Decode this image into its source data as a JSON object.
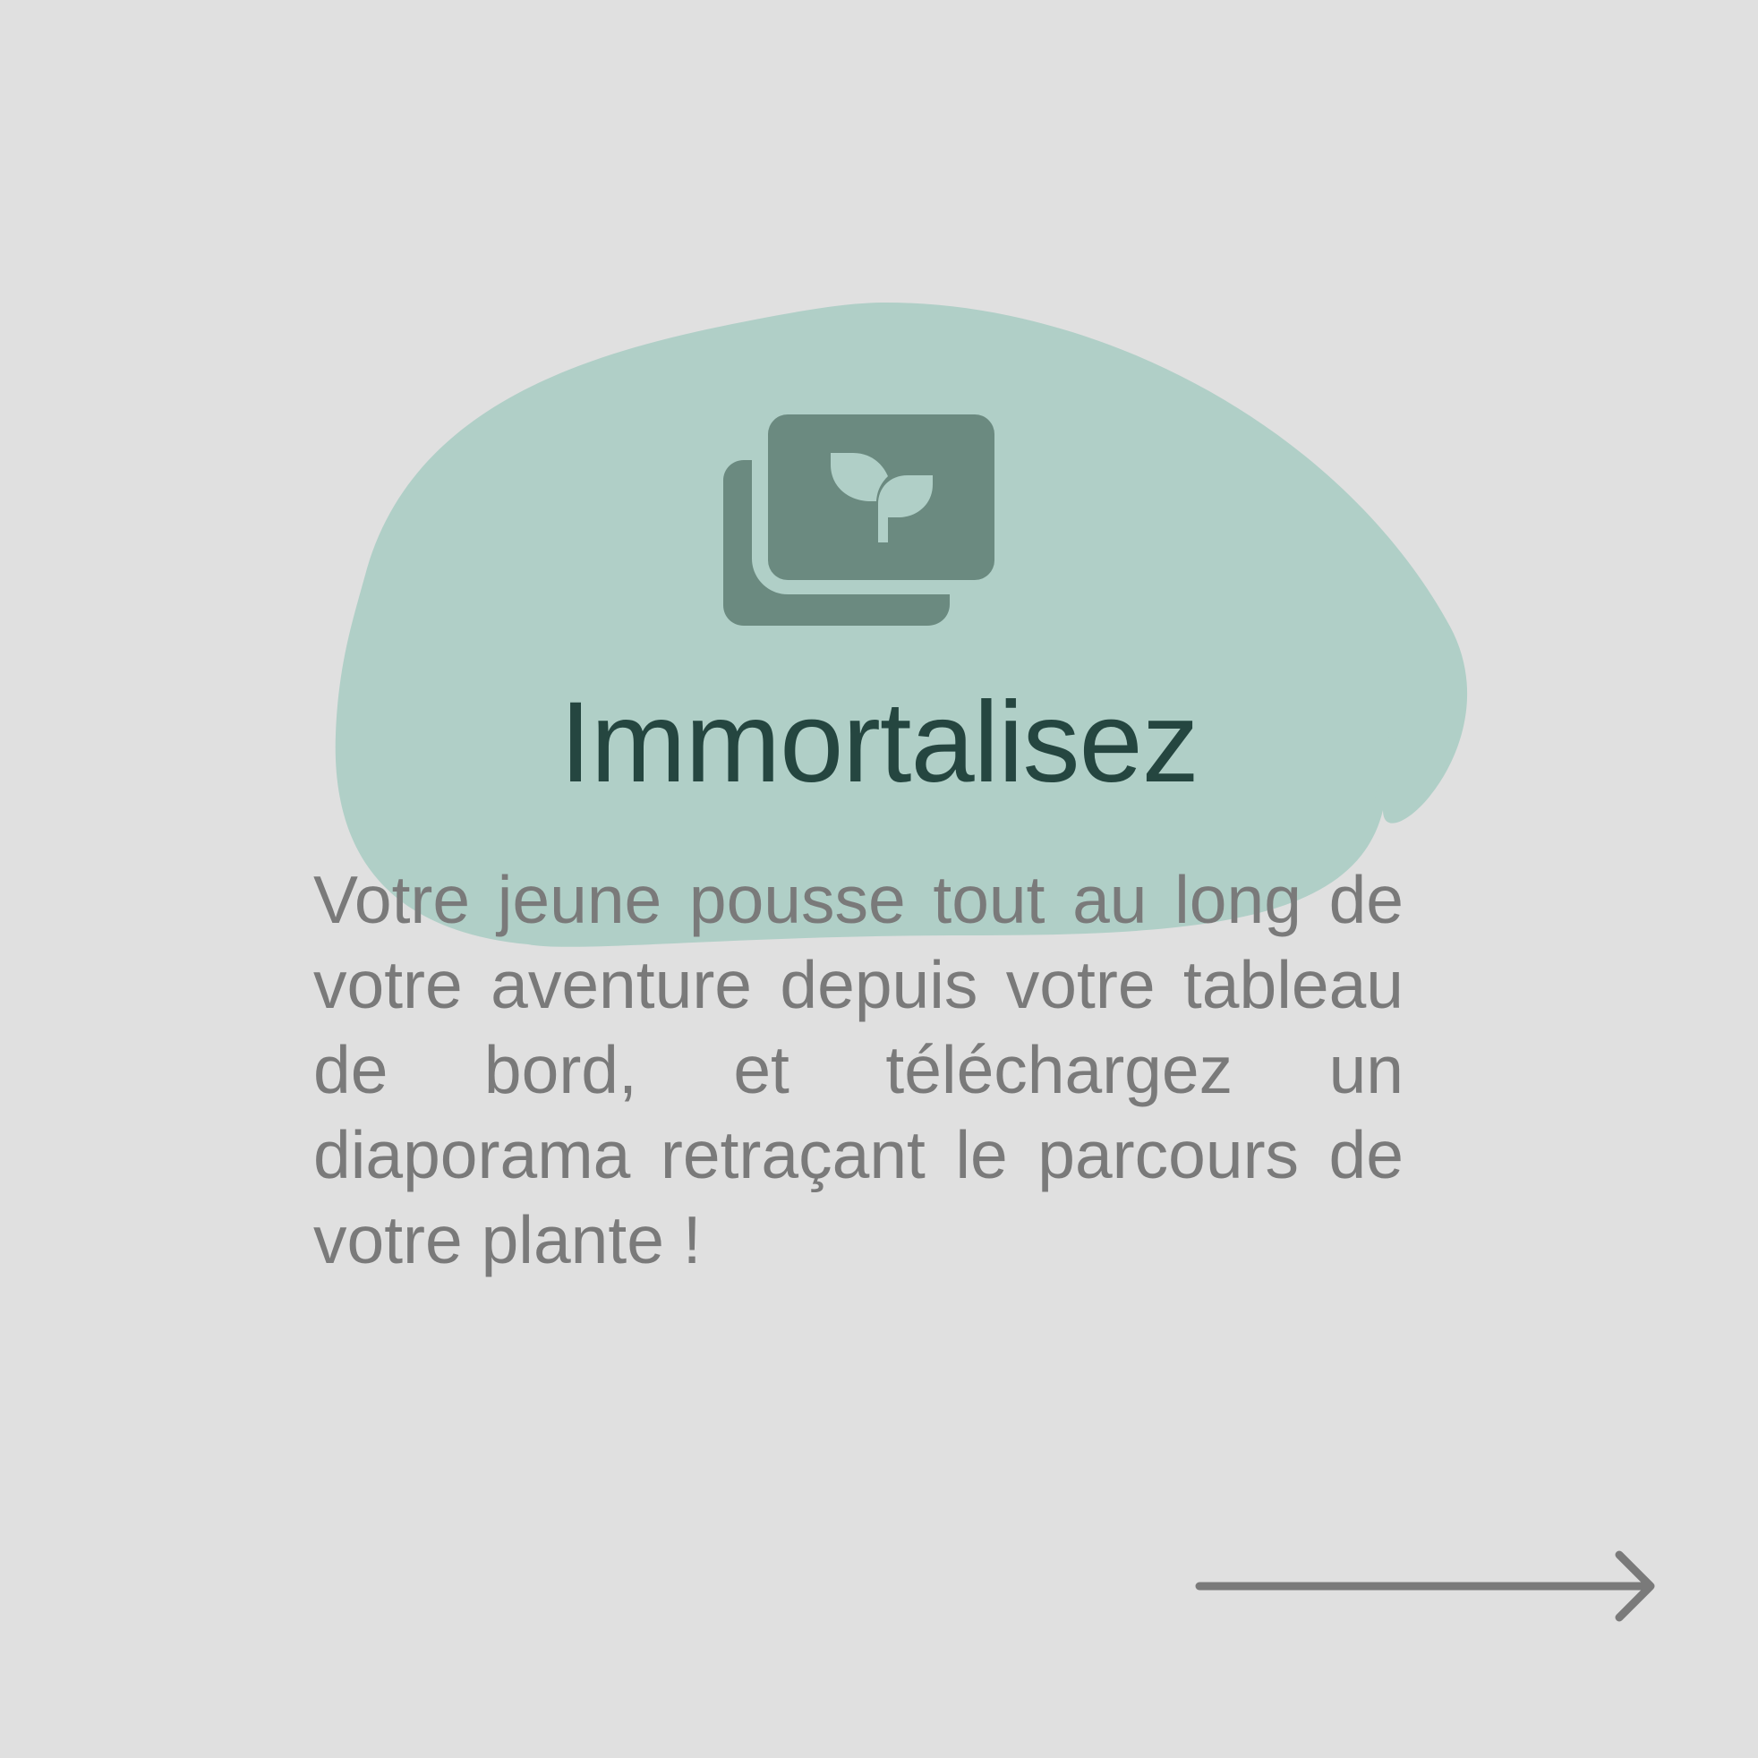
{
  "slide": {
    "title": "Immortalisez",
    "body": "Votre jeune pousse tout au long de votre aventure depuis votre tableau de bord, et téléchargez un diaporama retraçant le parcours de votre plante !"
  },
  "icons": {
    "hero": "photo-stack-sprout-icon",
    "next": "arrow-right-icon"
  },
  "colors": {
    "background": "#e0e0e0",
    "blob": "#b0cfc7",
    "icon": "#6b8a80",
    "title": "#254640",
    "body_text": "#7a7a7a",
    "arrow": "#7a7a7a"
  }
}
